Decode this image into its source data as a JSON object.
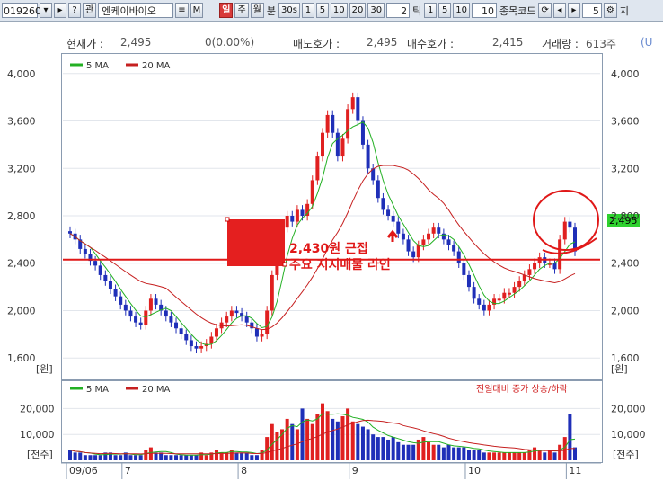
{
  "toolbar": {
    "code": "019260",
    "name": "엔케이바이오",
    "period_active": "일",
    "period_week": "주",
    "period_month": "월",
    "minute_label": "분",
    "minute_options": [
      "30s",
      "1",
      "5",
      "10",
      "20",
      "30"
    ],
    "count_value": "2",
    "tick_label": "틱",
    "tick_options": [
      "1",
      "5",
      "10"
    ],
    "tick_count": "10",
    "compare_label": "종목코드",
    "step_value": "5",
    "extra_label": "지"
  },
  "quote": {
    "price_label": "현재가 :",
    "price": "2,495",
    "change": "0(0.00%)",
    "ask_label": "매도호가 :",
    "ask": "2,495",
    "bid_label": "매수호가 :",
    "bid": "2,415",
    "volume_label": "거래량 :",
    "volume": "613주",
    "extra": "(U"
  },
  "price_chart": {
    "legend_ma5": "5 MA",
    "legend_ma20": "20 MA",
    "unit_label": "[원]",
    "ticks": [
      "4,000",
      "3,600",
      "3,200",
      "2,800",
      "2,400",
      "2,000",
      "1,600"
    ],
    "last_price_badge": "2,495",
    "support_price": 2430,
    "annotation_line1": "2,430원 근접",
    "annotation_line2": "주요 지지매물 라인",
    "colors": {
      "up": "#e02020",
      "down": "#1f2fb8",
      "ma5": "#23b023",
      "ma20": "#c62020",
      "annotation": "#e01818"
    }
  },
  "volume_chart": {
    "legend_ma5": "5 MA",
    "legend_ma20": "20 MA",
    "note": "전일대비 증가 상승/하락",
    "unit_label": "[천주]",
    "ticks": [
      "20,000",
      "10,000"
    ]
  },
  "x_axis": {
    "labels": [
      "09/06",
      "7",
      "8",
      "9",
      "10",
      "11"
    ]
  },
  "chart_data": {
    "type": "candlestick",
    "series_price_approx": [
      2650,
      2600,
      2520,
      2480,
      2420,
      2380,
      2300,
      2250,
      2180,
      2120,
      2050,
      2000,
      1950,
      1900,
      1880,
      2000,
      2100,
      2050,
      2000,
      1950,
      1900,
      1850,
      1800,
      1750,
      1700,
      1680,
      1700,
      1720,
      1780,
      1850,
      1900,
      1950,
      2000,
      1980,
      1950,
      1900,
      1850,
      1780,
      1800,
      2000,
      2300,
      2500,
      2700,
      2800,
      2750,
      2850,
      2800,
      2900,
      3100,
      3300,
      3500,
      3650,
      3500,
      3300,
      3450,
      3700,
      3800,
      3600,
      3400,
      3200,
      3100,
      2950,
      2850,
      2800,
      2750,
      2650,
      2600,
      2500,
      2450,
      2550,
      2600,
      2650,
      2700,
      2650,
      2600,
      2550,
      2500,
      2400,
      2300,
      2200,
      2100,
      2050,
      2000,
      2050,
      2100,
      2100,
      2150,
      2150,
      2200,
      2250,
      2300,
      2350,
      2400,
      2450,
      2400,
      2400,
      2350,
      2600,
      2750,
      2700,
      2500
    ],
    "volume_approx_thousands": [
      4,
      3,
      3,
      2,
      2,
      2,
      2,
      3,
      3,
      2,
      2,
      3,
      2,
      2,
      2,
      4,
      5,
      3,
      3,
      2,
      2,
      2,
      2,
      2,
      2,
      2,
      3,
      2,
      3,
      4,
      3,
      3,
      4,
      3,
      3,
      3,
      2,
      2,
      4,
      9,
      14,
      11,
      12,
      16,
      14,
      12,
      20,
      16,
      14,
      18,
      22,
      19,
      16,
      15,
      17,
      20,
      15,
      14,
      13,
      12,
      10,
      9,
      9,
      8,
      9,
      7,
      6,
      6,
      6,
      8,
      9,
      7,
      6,
      6,
      5,
      6,
      5,
      5,
      5,
      4,
      4,
      4,
      3,
      3,
      3,
      3,
      3,
      3,
      3,
      3,
      3,
      4,
      5,
      4,
      3,
      4,
      3,
      6,
      9,
      18,
      5
    ],
    "ylim_price": [
      1450,
      4150
    ],
    "ylim_volume": [
      0,
      25000
    ]
  }
}
